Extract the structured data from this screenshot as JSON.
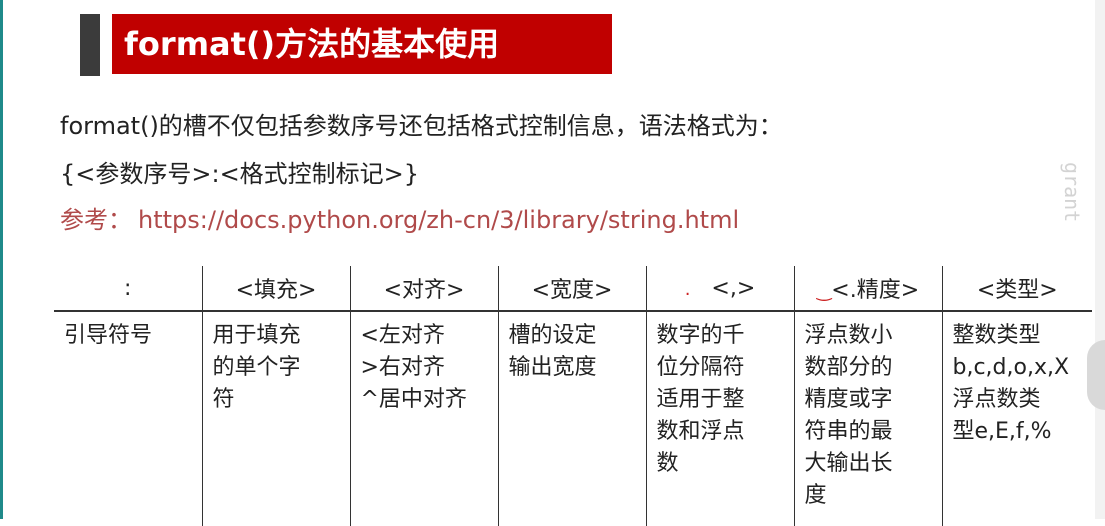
{
  "title": "format()方法的基本使用",
  "lines": {
    "intro": "format()的槽不仅包括参数序号还包括格式控制信息，语法格式为：",
    "syntax": "{<参数序号>:<格式控制标记>}",
    "ref_label": "参考：",
    "ref_url": "https://docs.python.org/zh-cn/3/library/string.html"
  },
  "watermark": "grant",
  "table": {
    "headers": [
      ":",
      "<填充>",
      "<对齐>",
      "<宽度>",
      "<,>",
      "<.精度>",
      "<类型>"
    ],
    "cells": [
      "引导符号",
      "用于填充\n的单个字\n符",
      "<左对齐\n>右对齐\n^居中对齐",
      "槽的设定\n输出宽度",
      "数字的千\n位分隔符\n适用于整\n数和浮点\n数",
      "浮点数小\n数部分的\n精度或字\n符串的最\n大输出长\n度",
      "整数类型\nb,c,d,o,x,X\n浮点数类\n型e,E,f,%"
    ]
  },
  "colors": {
    "title_bg": "#c00000",
    "accent": "#3b3b3b",
    "reference": "#b04a4a"
  }
}
